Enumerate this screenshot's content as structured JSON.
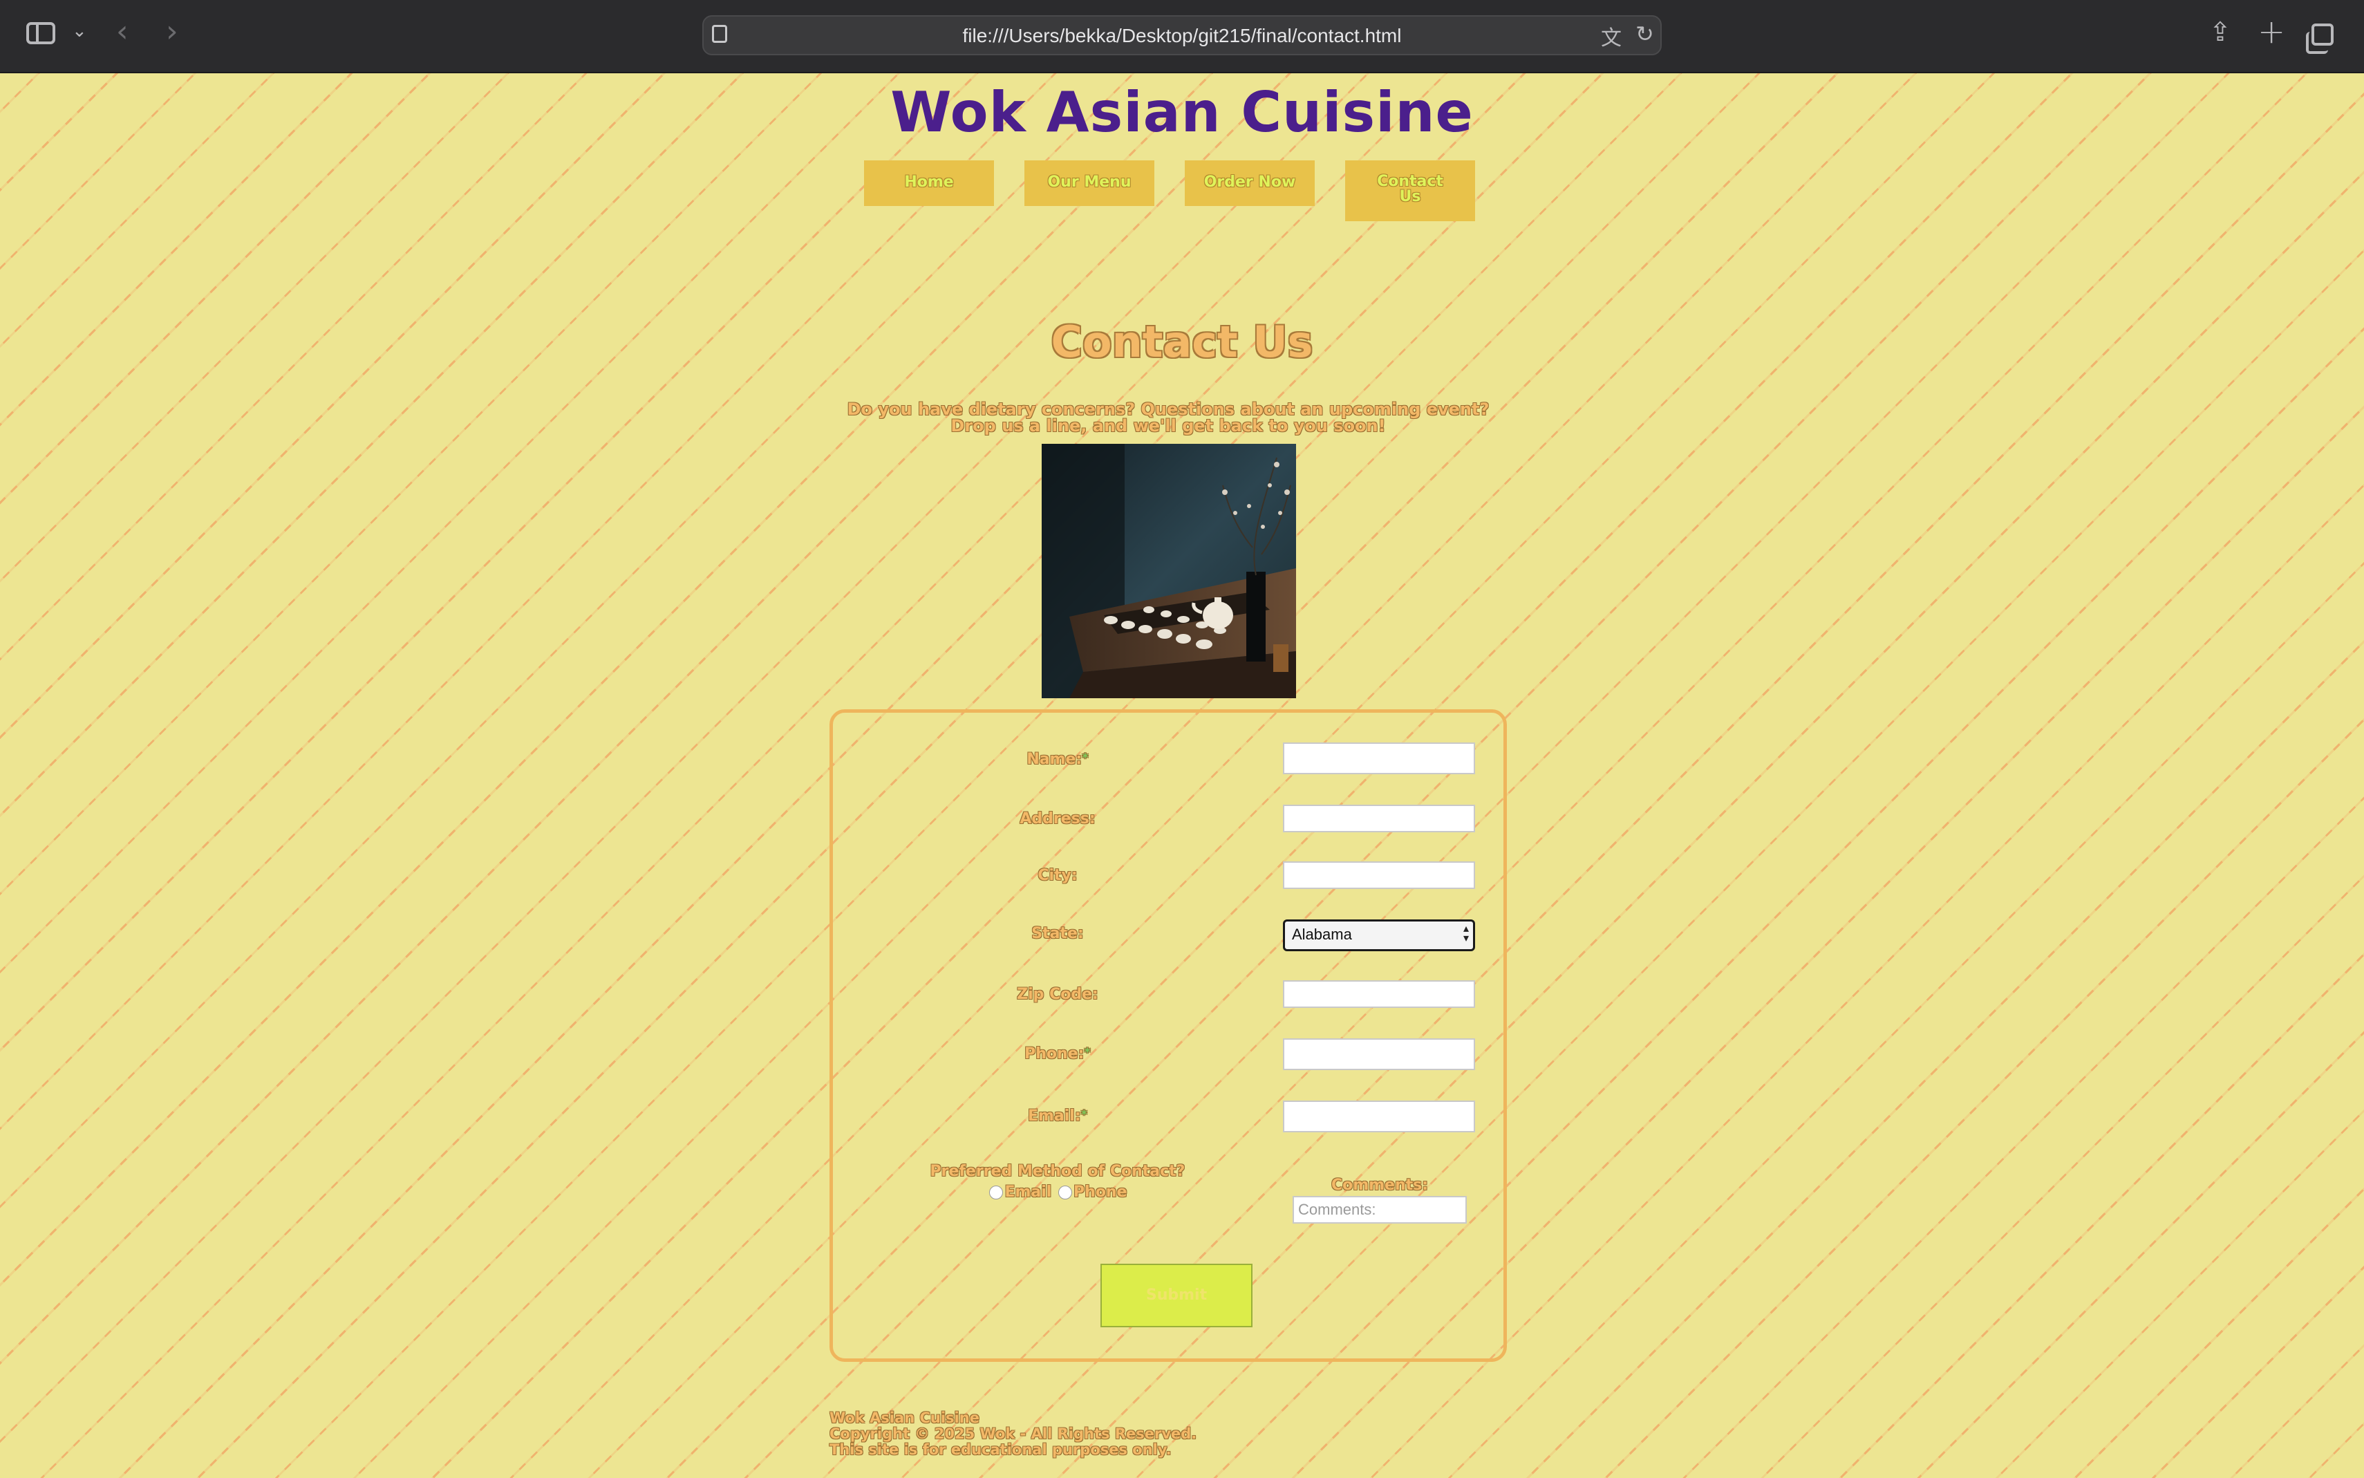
{
  "browser": {
    "url": "file:///Users/bekka/Desktop/git215/final/contact.html"
  },
  "site": {
    "title": "Wok Asian Cuisine"
  },
  "nav": {
    "items": [
      {
        "label": "Home"
      },
      {
        "label": "Our Menu"
      },
      {
        "label": "Order Now"
      },
      {
        "label": "Contact Us"
      }
    ]
  },
  "main": {
    "heading": "Contact Us",
    "intro": "Do you have dietary concerns? Questions about an upcoming event? Drop us a line, and we'll get back to you soon!"
  },
  "form": {
    "name_label": "Name:",
    "address_label": "Address:",
    "city_label": "City:",
    "state_label": "State:",
    "state_value": "Alabama",
    "zip_label": "Zip Code:",
    "phone_label": "Phone:",
    "email_label": "Email:",
    "required_mark": "*",
    "preferred_label": "Preferred Method of Contact?",
    "option_email": "Email",
    "option_phone": "Phone",
    "comments_label": "Comments:",
    "comments_placeholder": "Comments:",
    "submit_label": "Submit"
  },
  "footer": {
    "line1": "Wok Asian Cuisine",
    "line2": "Copyright © 2025 Wok - All Rights Reserved.",
    "line3": "This site is for educational purposes only."
  }
}
